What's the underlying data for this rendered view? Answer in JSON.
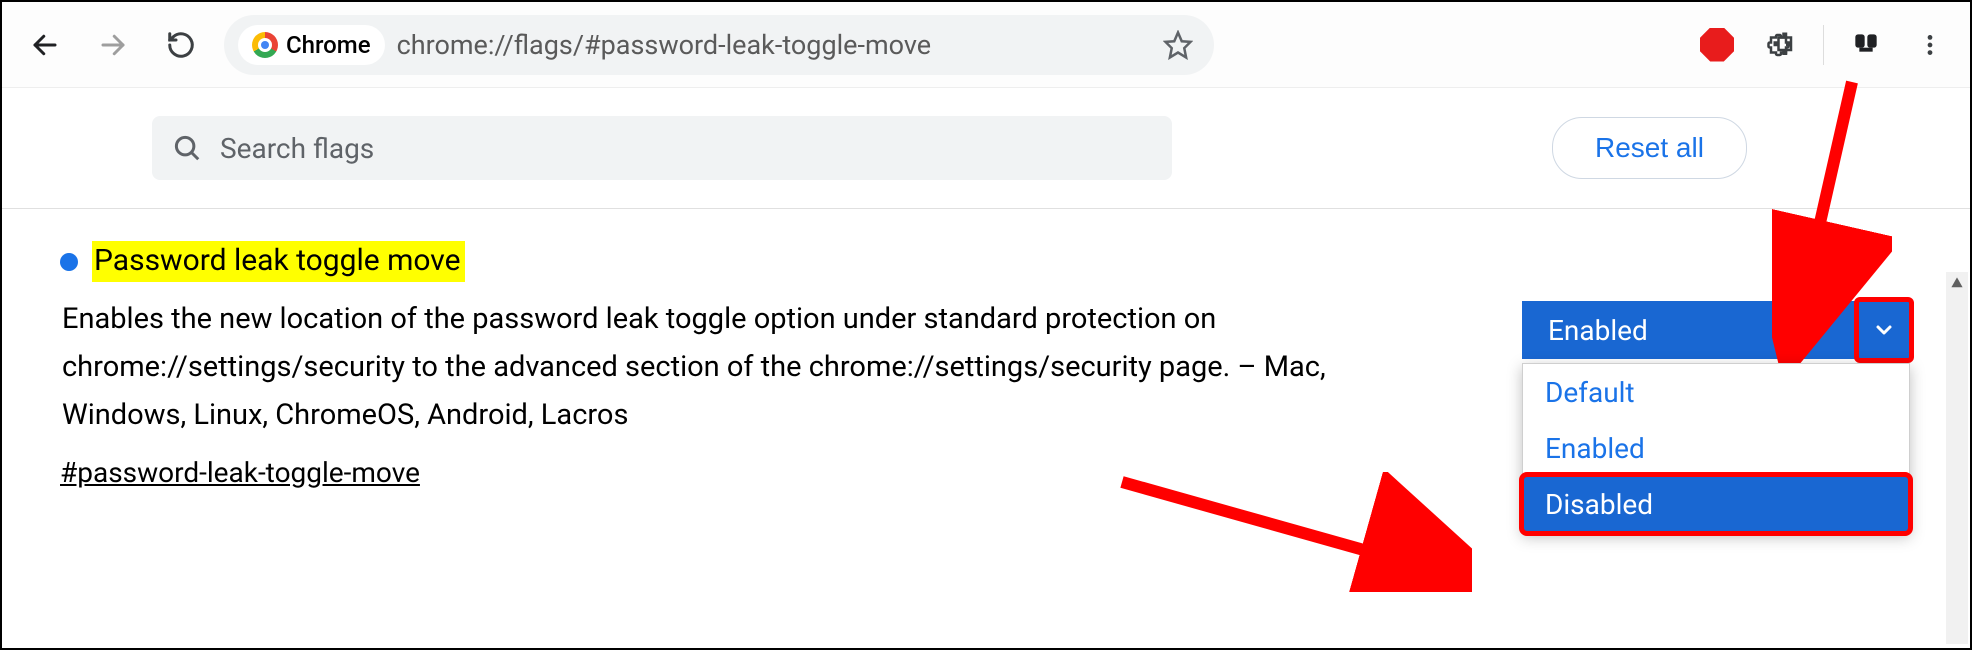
{
  "toolbar": {
    "chip_label": "Chrome",
    "url": "chrome://flags/#password-leak-toggle-move"
  },
  "flags_header": {
    "search_placeholder": "Search flags",
    "reset_label": "Reset all"
  },
  "flag": {
    "title": "Password leak toggle move",
    "description": "Enables the new location of the password leak toggle option under standard protection on chrome://settings/security to the advanced section of the chrome://settings/security page. – Mac, Windows, Linux, ChromeOS, Android, Lacros",
    "anchor": "#password-leak-toggle-move"
  },
  "dropdown": {
    "selected": "Enabled",
    "options": [
      "Default",
      "Enabled",
      "Disabled"
    ],
    "highlighted_index": 2
  }
}
